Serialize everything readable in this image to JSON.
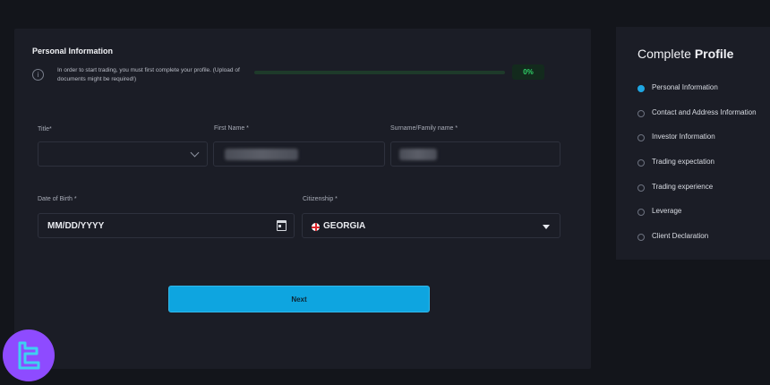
{
  "form": {
    "section_title": "Personal Information",
    "info_text": "In order to start trading, you must first complete your profile. (Upload of documents might be required!)",
    "progress": {
      "percent": 0,
      "label": "0%"
    },
    "fields": {
      "title": {
        "label": "Title*",
        "value": ""
      },
      "first_name": {
        "label": "First Name *"
      },
      "surname": {
        "label": "Surname/Family name *"
      },
      "dob": {
        "label": "Date of Birth *",
        "value": "MM/DD/YYYY"
      },
      "citizenship": {
        "label": "Citizenship *",
        "value": "GEORGIA"
      }
    },
    "next_label": "Next"
  },
  "sidebar": {
    "title_light": "Complete ",
    "title_bold": "Profile",
    "steps": [
      {
        "label": "Personal Information",
        "active": true
      },
      {
        "label": "Contact and Address Information",
        "active": false
      },
      {
        "label": "Investor Information",
        "active": false
      },
      {
        "label": "Trading expectation",
        "active": false
      },
      {
        "label": "Trading experience",
        "active": false
      },
      {
        "label": "Leverage",
        "active": false
      },
      {
        "label": "Client Declaration",
        "active": false
      }
    ]
  },
  "colors": {
    "accent": "#0ea5e0",
    "progress": "#22c55e",
    "logo": "#8e4bff"
  }
}
